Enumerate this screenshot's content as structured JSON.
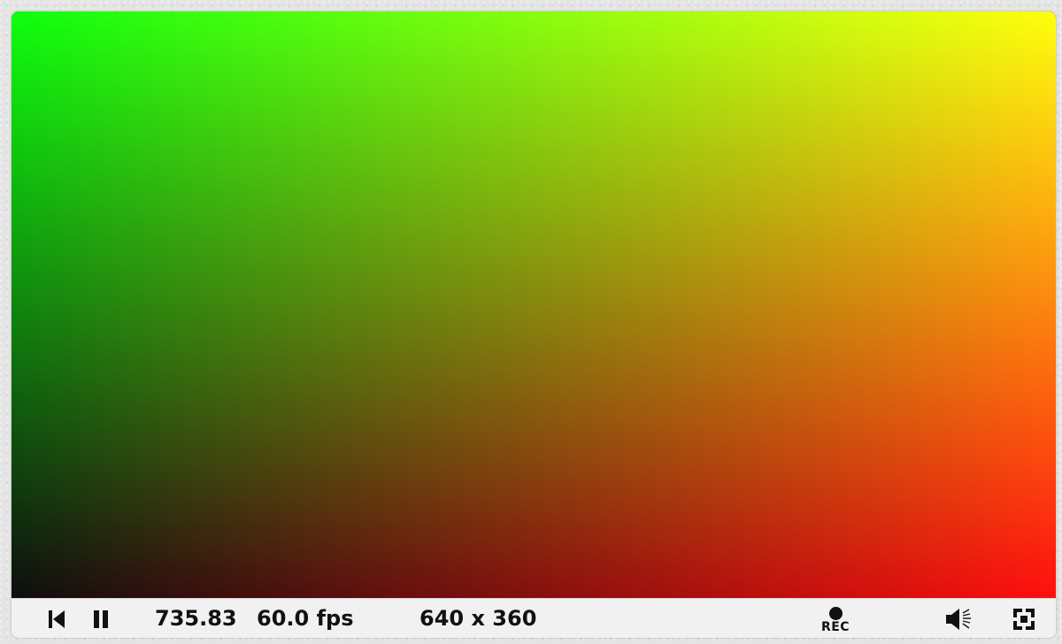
{
  "player": {
    "time": "735.83",
    "fps": "60.0 fps",
    "resolution": "640 x 360",
    "rec_label": "REC"
  },
  "icons": {
    "rewind": "skip-to-start-icon",
    "pause": "pause-icon",
    "record": "record-icon",
    "volume": "volume-icon",
    "fullscreen": "fullscreen-icon"
  },
  "colors": {
    "controls_background": "#f1f1f1",
    "icon_color": "#111111",
    "page_background": "#e4e4e4"
  }
}
